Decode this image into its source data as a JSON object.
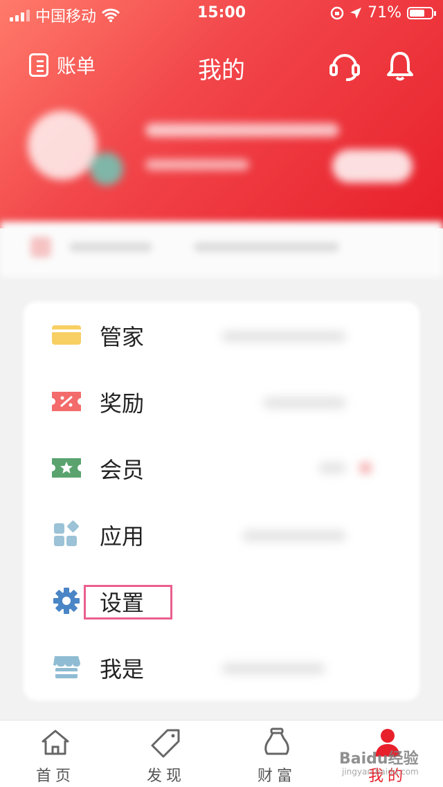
{
  "status_bar": {
    "carrier": "中国移动",
    "time": "15:00",
    "battery": "71%",
    "battery_level": 0.71
  },
  "nav": {
    "bill_label": "账单",
    "title": "我的"
  },
  "menu": {
    "items": [
      {
        "label": "管家",
        "icon": "card-icon"
      },
      {
        "label": "奖励",
        "icon": "coupon-icon"
      },
      {
        "label": "会员",
        "icon": "member-ticket-icon"
      },
      {
        "label": "应用",
        "icon": "apps-grid-icon"
      },
      {
        "label": "设置",
        "icon": "gear-icon"
      },
      {
        "label": "我是",
        "icon": "shop-icon"
      }
    ]
  },
  "tabbar": {
    "tabs": [
      {
        "label": "首页",
        "icon": "home-icon"
      },
      {
        "label": "发现",
        "icon": "tag-icon"
      },
      {
        "label": "财富",
        "icon": "money-bag-icon"
      },
      {
        "label": "我的",
        "icon": "person-icon",
        "active": true
      }
    ]
  },
  "watermark": {
    "text": "Baidu经验",
    "sub": "jingyan.baidu.com"
  },
  "colors": {
    "brand_red": "#e8202b",
    "highlight": "#ea5f8e"
  }
}
